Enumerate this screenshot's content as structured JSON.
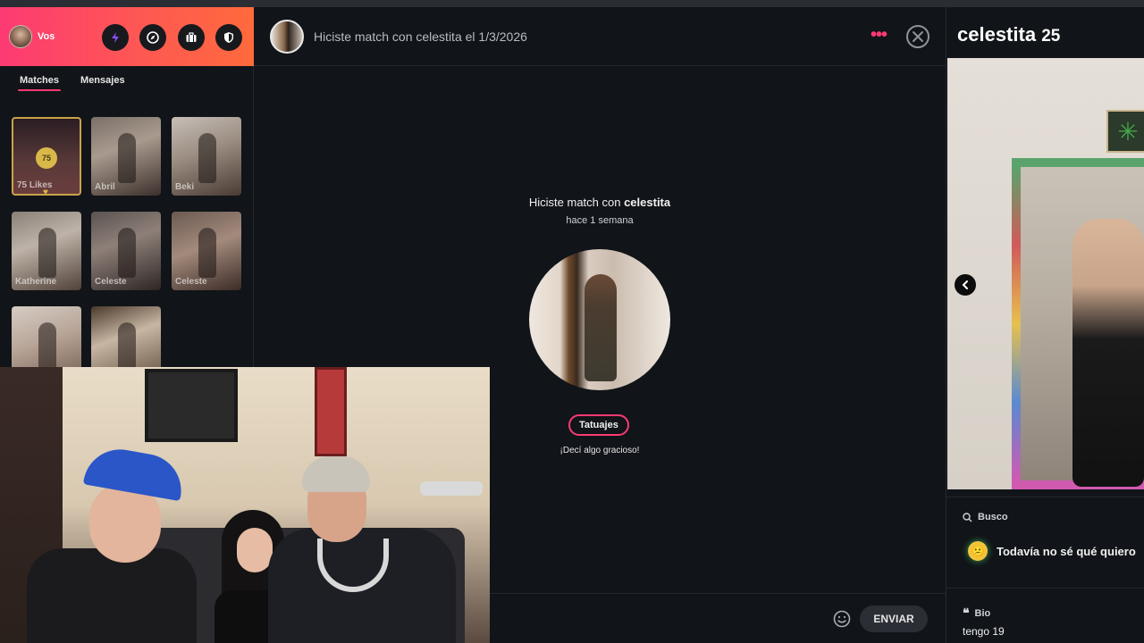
{
  "sidebar": {
    "profile_name": "Vos",
    "header_buttons": [
      "boost-icon",
      "explore-icon",
      "briefcase-icon",
      "shield-icon"
    ],
    "tabs": [
      {
        "label": "Matches",
        "active": true
      },
      {
        "label": "Mensajes",
        "active": false
      }
    ],
    "likes": {
      "count": "75",
      "label": "75 Likes"
    },
    "matches": [
      {
        "name": "Abril"
      },
      {
        "name": "Beki"
      },
      {
        "name": "Katherine"
      },
      {
        "name": "Celeste"
      },
      {
        "name": "Celeste"
      },
      {
        "name": ""
      },
      {
        "name": ""
      }
    ]
  },
  "chat": {
    "header_title": "Hiciste match con celestita el 1/3/2026",
    "match_prefix": "Hiciste match con ",
    "match_name": "celestita",
    "match_time": "hace 1 semana",
    "interest_pill": "Tatuajes",
    "hint": "¡Decí algo gracioso!",
    "send_label": "ENVIAR"
  },
  "profile": {
    "name": "celestita",
    "age": "25",
    "busco_label": "Busco",
    "busco_value": "Todavía no sé qué quiero",
    "bio_label": "Bio",
    "bio_value": "tengo 19"
  },
  "colors": {
    "brand_gradient_start": "#fd3a73",
    "brand_gradient_end": "#ff6a3c",
    "accent": "#fd3a73",
    "background": "#111418"
  }
}
